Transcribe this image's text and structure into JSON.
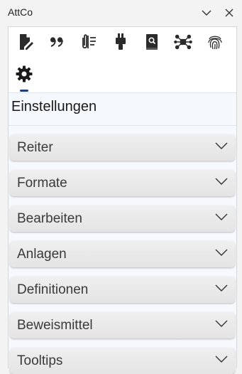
{
  "window": {
    "title": "AttCo",
    "collapse_icon": "chevron-down-icon",
    "close_icon": "close-icon"
  },
  "toolbar": {
    "tools": [
      {
        "name": "document-edit",
        "icon": "document-pencil-icon"
      },
      {
        "name": "quote",
        "icon": "quote-icon"
      },
      {
        "name": "attachment",
        "icon": "paperclip-list-icon"
      },
      {
        "name": "brush",
        "icon": "brush-icon"
      },
      {
        "name": "lookup",
        "icon": "book-search-icon"
      },
      {
        "name": "network",
        "icon": "network-icon"
      },
      {
        "name": "fingerprint",
        "icon": "fingerprint-icon"
      },
      {
        "name": "settings",
        "icon": "gear-icon",
        "active": true
      }
    ],
    "accent_color": "#1f3e7a"
  },
  "settings": {
    "title": "Einstellungen",
    "sections": [
      {
        "label": "Reiter"
      },
      {
        "label": "Formate"
      },
      {
        "label": "Bearbeiten"
      },
      {
        "label": "Anlagen"
      },
      {
        "label": "Definitionen"
      },
      {
        "label": "Beweismittel"
      },
      {
        "label": "Tooltips"
      }
    ]
  }
}
